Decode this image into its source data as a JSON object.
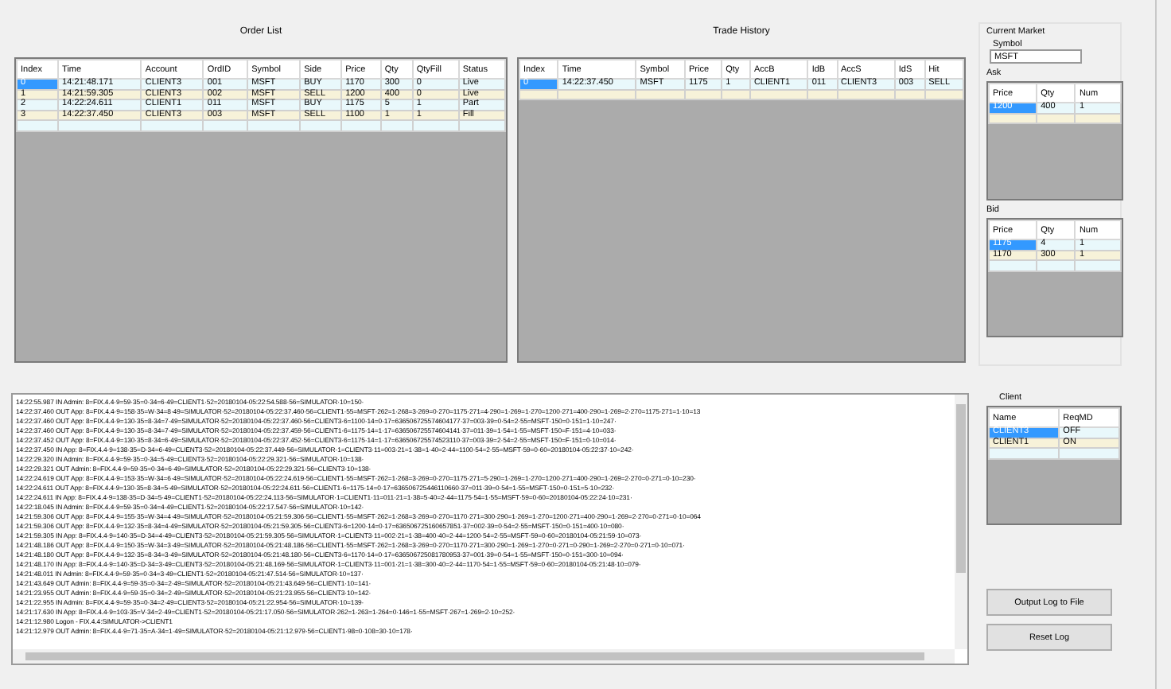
{
  "order_list": {
    "title": "Order List",
    "columns": [
      "Index",
      "Time",
      "Account",
      "OrdID",
      "Symbol",
      "Side",
      "Price",
      "Qty",
      "QtyFill",
      "Status"
    ],
    "rows": [
      {
        "selected": true,
        "cells": [
          "0",
          "14:21:48.171",
          "CLIENT3",
          "001",
          "MSFT",
          "BUY",
          "1170",
          "300",
          "0",
          "Live"
        ]
      },
      {
        "selected": false,
        "cells": [
          "1",
          "14:21:59.305",
          "CLIENT3",
          "002",
          "MSFT",
          "SELL",
          "1200",
          "400",
          "0",
          "Live"
        ]
      },
      {
        "selected": false,
        "cells": [
          "2",
          "14:22:24.611",
          "CLIENT1",
          "011",
          "MSFT",
          "BUY",
          "1175",
          "5",
          "1",
          "Part"
        ]
      },
      {
        "selected": false,
        "cells": [
          "3",
          "14:22:37.450",
          "CLIENT3",
          "003",
          "MSFT",
          "SELL",
          "1100",
          "1",
          "1",
          "Fill"
        ]
      }
    ]
  },
  "trade_history": {
    "title": "Trade History",
    "columns": [
      "Index",
      "Time",
      "Symbol",
      "Price",
      "Qty",
      "AccB",
      "IdB",
      "AccS",
      "IdS",
      "Hit"
    ],
    "rows": [
      {
        "selected": true,
        "cells": [
          "0",
          "14:22:37.450",
          "MSFT",
          "1175",
          "1",
          "CLIENT1",
          "011",
          "CLIENT3",
          "003",
          "SELL"
        ]
      }
    ]
  },
  "current_market": {
    "title": "Current Market",
    "symbol_label": "Symbol",
    "symbol": "MSFT",
    "ask": {
      "label": "Ask",
      "columns": [
        "Price",
        "Qty",
        "Num"
      ],
      "rows": [
        {
          "selected": true,
          "cells": [
            "1200",
            "400",
            "1"
          ]
        }
      ]
    },
    "bid": {
      "label": "Bid",
      "columns": [
        "Price",
        "Qty",
        "Num"
      ],
      "rows": [
        {
          "selected": true,
          "cells": [
            "1175",
            "4",
            "1"
          ]
        },
        {
          "selected": false,
          "cells": [
            "1170",
            "300",
            "1"
          ]
        }
      ]
    }
  },
  "log": {
    "lines": [
      "14:22:55.987 IN Admin: 8=FIX.4.4·9=59·35=0·34=6·49=CLIENT1·52=20180104-05:22:54.588·56=SIMULATOR·10=150·",
      "14:22:37.460 OUT App: 8=FIX.4.4·9=158·35=W·34=8·49=SIMULATOR·52=20180104-05:22:37.460·56=CLIENT1·55=MSFT·262=1·268=3·269=0·270=1175·271=4·290=1·269=1·270=1200·271=400·290=1·269=2·270=1175·271=1·10=13",
      "14:22:37.460 OUT App: 8=FIX.4.4·9=130·35=8·34=7·49=SIMULATOR·52=20180104-05:22:37.460·56=CLIENT3·6=1100·14=0·17=636506725574604177·37=003·39=0·54=2·55=MSFT·150=0·151=1·10=247·",
      "14:22:37.460 OUT App: 8=FIX.4.4·9=130·35=8·34=7·49=SIMULATOR·52=20180104-05:22:37.459·56=CLIENT1·6=1175·14=1·17=636506725574604141·37=011·39=1·54=1·55=MSFT·150=F·151=4·10=033·",
      "14:22:37.452 OUT App: 8=FIX.4.4·9=130·35=8·34=6·49=SIMULATOR·52=20180104-05:22:37.452·56=CLIENT3·6=1175·14=1·17=636506725574523110·37=003·39=2·54=2·55=MSFT·150=F·151=0·10=014·",
      "14:22:37.450 IN App: 8=FIX.4.4·9=138·35=D·34=6·49=CLIENT3·52=20180104-05:22:37.449·56=SIMULATOR·1=CLIENT3·11=003·21=1·38=1·40=2·44=1100·54=2·55=MSFT·59=0·60=20180104-05:22:37·10=242·",
      "14:22:29.320 IN Admin: 8=FIX.4.4·9=59·35=0·34=5·49=CLIENT3·52=20180104-05:22:29.321·56=SIMULATOR·10=138·",
      "14:22:29.321 OUT Admin: 8=FIX.4.4·9=59·35=0·34=6·49=SIMULATOR·52=20180104-05:22:29.321·56=CLIENT3·10=138·",
      "14:22:24.619 OUT App: 8=FIX.4.4·9=153·35=W·34=6·49=SIMULATOR·52=20180104-05:22:24.619·56=CLIENT1·55=MSFT·262=1·268=3·269=0·270=1175·271=5·290=1·269=1·270=1200·271=400·290=1·269=2·270=0·271=0·10=230·",
      "14:22:24.611 OUT App: 8=FIX.4.4·9=130·35=8·34=5·49=SIMULATOR·52=20180104-05:22:24.611·56=CLIENT1·6=1175·14=0·17=636506725446110660·37=011·39=0·54=1·55=MSFT·150=0·151=5·10=232·",
      "14:22:24.611 IN App: 8=FIX.4.4·9=138·35=D·34=5·49=CLIENT1·52=20180104-05:22:24.113·56=SIMULATOR·1=CLIENT1·11=011·21=1·38=5·40=2·44=1175·54=1·55=MSFT·59=0·60=20180104-05:22:24·10=231·",
      "14:22:18.045 IN Admin: 8=FIX.4.4·9=59·35=0·34=4·49=CLIENT1·52=20180104-05:22:17.547·56=SIMULATOR·10=142·",
      "14:21:59.306 OUT App: 8=FIX.4.4·9=155·35=W·34=4·49=SIMULATOR·52=20180104-05:21:59.306·56=CLIENT1·55=MSFT·262=1·268=3·269=0·270=1170·271=300·290=1·269=1·270=1200·271=400·290=1·269=2·270=0·271=0·10=064",
      "14:21:59.306 OUT App: 8=FIX.4.4·9=132·35=8·34=4·49=SIMULATOR·52=20180104-05:21:59.305·56=CLIENT3·6=1200·14=0·17=636506725160657851·37=002·39=0·54=2·55=MSFT·150=0·151=400·10=080·",
      "14:21:59.305 IN App: 8=FIX.4.4·9=140·35=D·34=4·49=CLIENT3·52=20180104-05:21:59.305·56=SIMULATOR·1=CLIENT3·11=002·21=1·38=400·40=2·44=1200·54=2·55=MSFT·59=0·60=20180104-05:21:59·10=073·",
      "14:21:48.186 OUT App: 8=FIX.4.4·9=150·35=W·34=3·49=SIMULATOR·52=20180104-05:21:48.186·56=CLIENT1·55=MSFT·262=1·268=3·269=0·270=1170·271=300·290=1·269=1·270=0·271=0·290=1·269=2·270=0·271=0·10=071·",
      "14:21:48.180 OUT App: 8=FIX.4.4·9=132·35=8·34=3·49=SIMULATOR·52=20180104-05:21:48.180·56=CLIENT3·6=1170·14=0·17=636506725081780953·37=001·39=0·54=1·55=MSFT·150=0·151=300·10=094·",
      "14:21:48.170 IN App: 8=FIX.4.4·9=140·35=D·34=3·49=CLIENT3·52=20180104-05:21:48.169·56=SIMULATOR·1=CLIENT3·11=001·21=1·38=300·40=2·44=1170·54=1·55=MSFT·59=0·60=20180104-05:21:48·10=079·",
      "14:21:48.011 IN Admin: 8=FIX.4.4·9=59·35=0·34=3·49=CLIENT1·52=20180104-05:21:47.514·56=SIMULATOR·10=137·",
      "14:21:43.649 OUT Admin: 8=FIX.4.4·9=59·35=0·34=2·49=SIMULATOR·52=20180104-05:21:43.649·56=CLIENT1·10=141·",
      "14:21:23.955 OUT Admin: 8=FIX.4.4·9=59·35=0·34=2·49=SIMULATOR·52=20180104-05:21:23.955·56=CLIENT3·10=142·",
      "14:21:22.955 IN Admin: 8=FIX.4.4·9=59·35=0·34=2·49=CLIENT3·52=20180104-05:21:22.954·56=SIMULATOR·10=139·",
      "14:21:17.630 IN App: 8=FIX.4.4·9=103·35=V·34=2·49=CLIENT1·52=20180104-05:21:17.050·56=SIMULATOR·262=1·263=1·264=0·146=1·55=MSFT·267=1·269=2·10=252·",
      "14:21:12.980 Logon - FIX.4.4:SIMULATOR->CLIENT1",
      "14:21:12.979 OUT Admin: 8=FIX.4.4·9=71·35=A·34=1·49=SIMULATOR·52=20180104-05:21:12.979·56=CLIENT1·98=0·108=30·10=178·"
    ]
  },
  "client": {
    "title": "Client",
    "columns": [
      "Name",
      "ReqMD"
    ],
    "rows": [
      {
        "selected": true,
        "cells": [
          "CLIENT3",
          "OFF"
        ]
      },
      {
        "selected": false,
        "cells": [
          "CLIENT1",
          "ON"
        ]
      }
    ]
  },
  "buttons": [
    "Output Log to File",
    "Reset Log"
  ]
}
